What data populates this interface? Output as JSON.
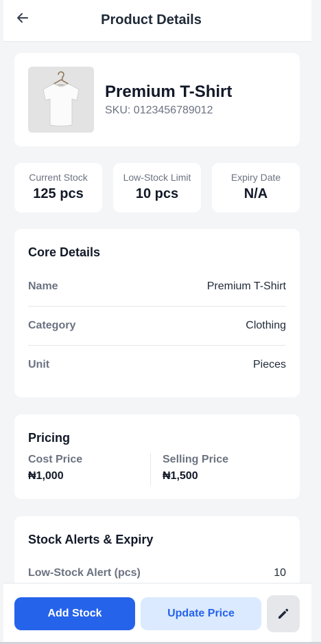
{
  "header": {
    "title": "Product Details",
    "back_icon": "arrow-left-icon"
  },
  "product": {
    "name": "Premium T-Shirt",
    "sku": "SKU: 0123456789012",
    "image_icon": "tshirt-image"
  },
  "stats": [
    {
      "label": "Current Stock",
      "value": "125 pcs"
    },
    {
      "label": "Low-Stock Limit",
      "value": "10 pcs"
    },
    {
      "label": "Expiry Date",
      "value": "N/A"
    }
  ],
  "core_details": {
    "title": "Core Details",
    "rows": [
      {
        "key": "Name",
        "value": "Premium T-Shirt"
      },
      {
        "key": "Category",
        "value": "Clothing"
      },
      {
        "key": "Unit",
        "value": "Pieces"
      }
    ]
  },
  "pricing": {
    "title": "Pricing",
    "cost_label": "Cost Price",
    "cost_value": "₦1,000",
    "selling_label": "Selling Price",
    "selling_value": "₦1,500"
  },
  "alerts": {
    "title": "Stock Alerts & Expiry",
    "rows": [
      {
        "key": "Low-Stock Alert (pcs)",
        "value": "10"
      }
    ]
  },
  "actions": {
    "add_stock": "Add Stock",
    "update_price": "Update Price",
    "edit_icon": "pencil-icon"
  },
  "colors": {
    "primary": "#2563eb",
    "primary_light": "#dbeafe",
    "background": "#f4f5f7"
  }
}
